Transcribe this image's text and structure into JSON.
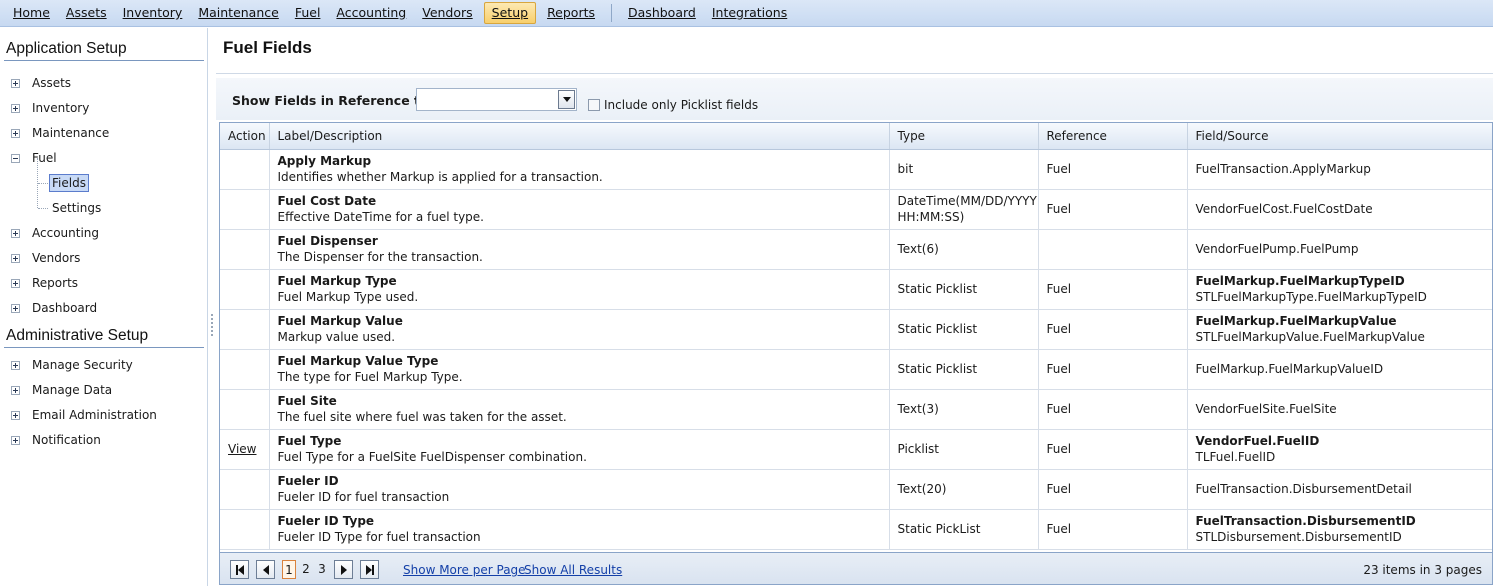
{
  "menu": {
    "items": [
      "Home",
      "Assets",
      "Inventory",
      "Maintenance",
      "Fuel",
      "Accounting",
      "Vendors",
      "Setup",
      "Reports"
    ],
    "active": "Setup",
    "right_items": [
      "Dashboard",
      "Integrations"
    ]
  },
  "sidebar": {
    "app_setup_title": "Application Setup",
    "admin_setup_title": "Administrative Setup",
    "app_items": {
      "assets": "Assets",
      "inventory": "Inventory",
      "maintenance": "Maintenance",
      "fuel": "Fuel",
      "fields": "Fields",
      "settings": "Settings",
      "accounting": "Accounting",
      "vendors": "Vendors",
      "reports": "Reports",
      "dashboard": "Dashboard"
    },
    "admin_items": {
      "security": "Manage Security",
      "data": "Manage Data",
      "email": "Email Administration",
      "notification": "Notification"
    }
  },
  "page": {
    "title": "Fuel Fields",
    "filter_label": "Show Fields in Reference to:",
    "filter_value": "",
    "picklist_label": "Include only Picklist fields",
    "picklist_checked": false
  },
  "grid": {
    "headers": [
      "Action",
      "Label/Description",
      "Type",
      "Reference",
      "Field/Source"
    ],
    "rows": [
      {
        "action": "",
        "label": "Apply Markup",
        "desc": "Identifies whether Markup is applied for a transaction.",
        "type": "bit",
        "ref": "Fuel",
        "src1": "FuelTransaction.ApplyMarkup",
        "src1_bold": false,
        "src2": ""
      },
      {
        "action": "",
        "label": "Fuel Cost Date",
        "desc": "Effective DateTime for a fuel type.",
        "type": "DateTime(MM/DD/YYYY HH:MM:SS)",
        "ref": "Fuel",
        "src1": "VendorFuelCost.FuelCostDate",
        "src1_bold": false,
        "src2": ""
      },
      {
        "action": "",
        "label": "Fuel Dispenser",
        "desc": "The Dispenser for the transaction.",
        "type": "Text(6)",
        "ref": "",
        "src1": "VendorFuelPump.FuelPump",
        "src1_bold": false,
        "src2": ""
      },
      {
        "action": "",
        "label": "Fuel Markup Type",
        "desc": "Fuel Markup Type used.",
        "type": "Static Picklist",
        "ref": "Fuel",
        "src1": "FuelMarkup.FuelMarkupTypeID",
        "src1_bold": true,
        "src2": "STLFuelMarkupType.FuelMarkupTypeID"
      },
      {
        "action": "",
        "label": "Fuel Markup Value",
        "desc": "Markup value used.",
        "type": "Static Picklist",
        "ref": "Fuel",
        "src1": "FuelMarkup.FuelMarkupValue",
        "src1_bold": true,
        "src2": "STLFuelMarkupValue.FuelMarkupValue"
      },
      {
        "action": "",
        "label": "Fuel Markup Value Type",
        "desc": "The type for Fuel Markup Type.",
        "type": "Static Picklist",
        "ref": "Fuel",
        "src1": "FuelMarkup.FuelMarkupValueID",
        "src1_bold": false,
        "src2": ""
      },
      {
        "action": "",
        "label": "Fuel Site",
        "desc": "The fuel site where fuel was taken for the asset.",
        "type": "Text(3)",
        "ref": "Fuel",
        "src1": "VendorFuelSite.FuelSite",
        "src1_bold": false,
        "src2": ""
      },
      {
        "action": "View",
        "label": "Fuel Type",
        "desc": "Fuel Type for a FuelSite FuelDispenser combination.",
        "type": "Picklist",
        "ref": "Fuel",
        "src1": "VendorFuel.FuelID",
        "src1_bold": true,
        "src2": "TLFuel.FuelID"
      },
      {
        "action": "",
        "label": "Fueler ID",
        "desc": "Fueler ID for fuel transaction",
        "type": "Text(20)",
        "ref": "Fuel",
        "src1": "FuelTransaction.DisbursementDetail",
        "src1_bold": false,
        "src2": ""
      },
      {
        "action": "",
        "label": "Fueler ID Type",
        "desc": "Fueler ID Type for fuel transaction",
        "type": "Static PickList",
        "ref": "Fuel",
        "src1": "FuelTransaction.DisbursementID",
        "src1_bold": true,
        "src2": "STLDisbursement.DisbursementID"
      }
    ]
  },
  "pager": {
    "pages": [
      "1",
      "2",
      "3"
    ],
    "current": "1",
    "show_more": "Show More per Page",
    "show_all": "Show All Results",
    "info": "23 items in 3 pages"
  }
}
